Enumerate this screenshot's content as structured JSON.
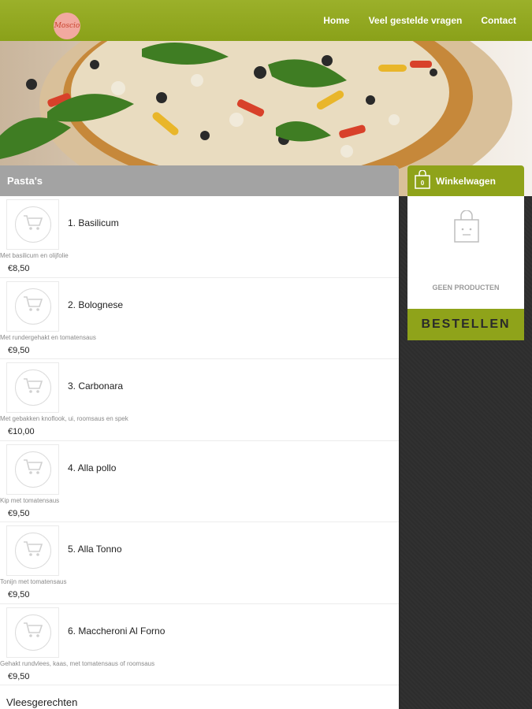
{
  "header": {
    "logo_text": "Moscio",
    "nav": [
      "Home",
      "Veel gestelde vragen",
      "Contact"
    ]
  },
  "menu": {
    "category": "Pasta's",
    "items": [
      {
        "name": "1. Basilicum",
        "description": "Met basilicum en olijfolie",
        "price": "€8,50"
      },
      {
        "name": "2. Bolognese",
        "description": "Met rundergehakt en tomatensaus",
        "price": "€9,50"
      },
      {
        "name": "3. Carbonara",
        "description": "Met gebakken knoflook, ui, roomsaus en spek",
        "price": "€10,00"
      },
      {
        "name": "4. Alla pollo",
        "description": "Kip met tomatensaus",
        "price": "€9,50"
      },
      {
        "name": "5. Alla Tonno",
        "description": "Tonijn met tomatensaus",
        "price": "€9,50"
      },
      {
        "name": "6. Maccheroni Al Forno",
        "description": "Gehakt rundvlees, kaas, met tomatensaus of roomsaus",
        "price": "€9,50"
      }
    ],
    "next_category": "Vleesgerechten"
  },
  "cart": {
    "title": "Winkelwagen",
    "count": "0",
    "empty_text": "GEEN PRODUCTEN",
    "order_label": "BESTELLEN"
  },
  "colors": {
    "brand_green": "#8fa31a",
    "category_grey": "#a3a3a3"
  }
}
